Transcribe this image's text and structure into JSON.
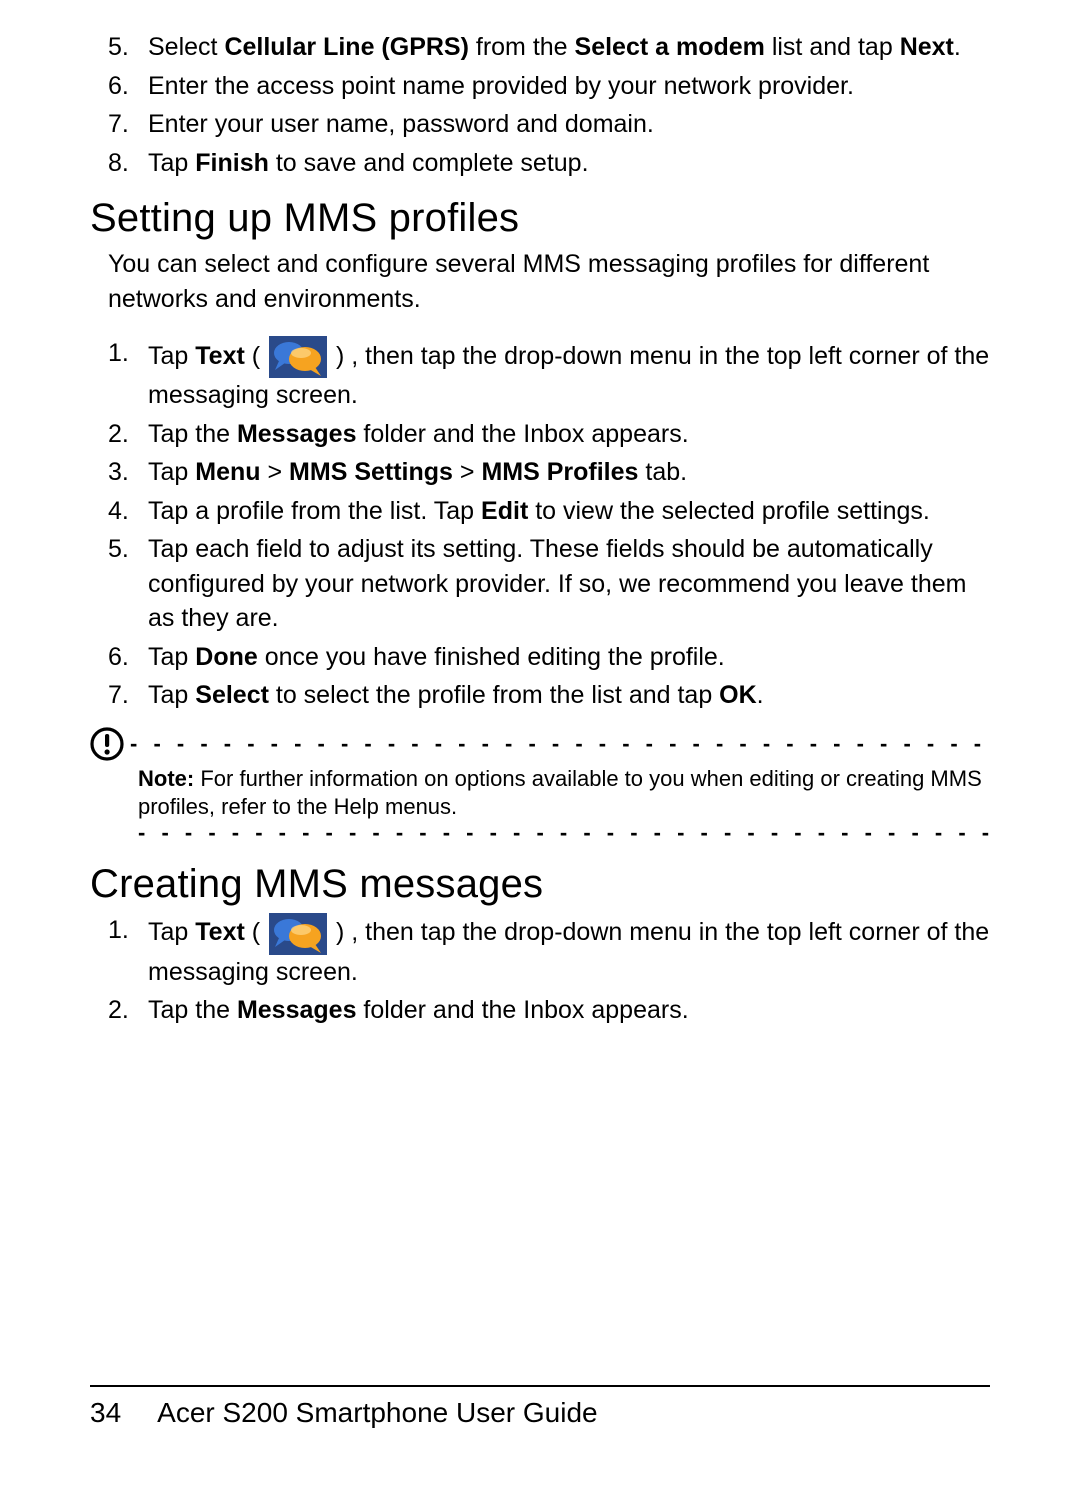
{
  "topSteps": [
    {
      "n": "5.",
      "html": "Select <b>Cellular Line (GPRS)</b> from the <b>Select a modem</b> list and tap <b>Next</b>."
    },
    {
      "n": "6.",
      "html": "Enter the access point name provided by your network provider."
    },
    {
      "n": "7.",
      "html": "Enter your user name, password and domain."
    },
    {
      "n": "8.",
      "html": "Tap <b>Finish</b> to save and complete setup."
    }
  ],
  "section1": {
    "heading": "Setting up MMS profiles",
    "intro": "You can select and configure several MMS messaging profiles for different networks and environments.",
    "steps": [
      {
        "n": "1.",
        "html": "Tap <b>Text</b> ( __ICON__ ) , then tap the drop-down menu in the top left corner of the messaging screen."
      },
      {
        "n": "2.",
        "html": "Tap the <b>Messages</b> folder and the Inbox appears."
      },
      {
        "n": "3.",
        "html": "Tap <b>Menu</b> > <b>MMS Settings</b> > <b>MMS Profiles</b> tab."
      },
      {
        "n": "4.",
        "html": "Tap a profile from the list. Tap <b>Edit</b> to view the selected profile settings."
      },
      {
        "n": "5.",
        "html": "Tap each field to adjust its setting. These fields should be automatically configured by your network provider. If so, we recommend you leave them as they are."
      },
      {
        "n": "6.",
        "html": "Tap <b>Done</b> once you have finished editing the profile."
      },
      {
        "n": "7.",
        "html": "Tap <b>Select</b> to select the profile from the list and tap <b>OK</b>."
      }
    ]
  },
  "note": {
    "label": "Note:",
    "body": "For further information on options available to you when editing or creating MMS profiles, refer to the Help menus.",
    "dashes": "- - - - - - - - - - - - - - - - - - - - - - - - - - - - - - - - - - - - -"
  },
  "section2": {
    "heading": "Creating MMS messages",
    "steps": [
      {
        "n": "1.",
        "html": "Tap <b>Text</b> ( __ICON__ ) , then tap the drop-down menu in the top left corner of the messaging screen."
      },
      {
        "n": "2.",
        "html": "Tap the <b>Messages</b> folder and the Inbox appears."
      }
    ]
  },
  "footer": {
    "page": "34",
    "title": "Acer S200 Smartphone User Guide"
  }
}
